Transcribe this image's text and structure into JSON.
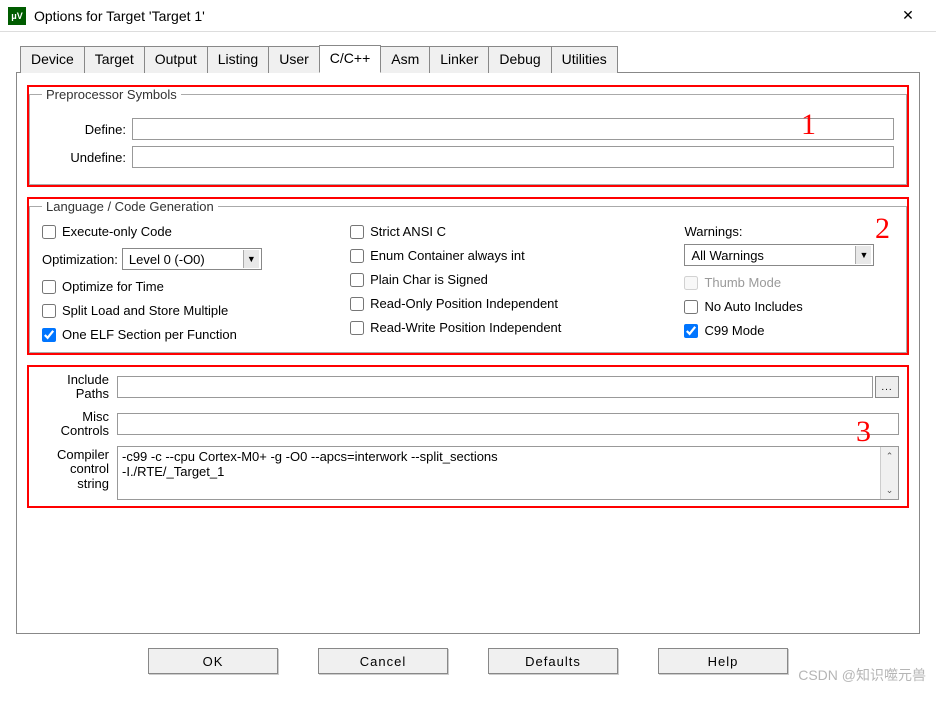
{
  "window": {
    "title": "Options for Target 'Target 1'",
    "icon_label": "μV"
  },
  "tabs": [
    {
      "label": "Device"
    },
    {
      "label": "Target"
    },
    {
      "label": "Output"
    },
    {
      "label": "Listing"
    },
    {
      "label": "User"
    },
    {
      "label": "C/C++"
    },
    {
      "label": "Asm"
    },
    {
      "label": "Linker"
    },
    {
      "label": "Debug"
    },
    {
      "label": "Utilities"
    }
  ],
  "active_tab": "C/C++",
  "preproc": {
    "legend": "Preprocessor Symbols",
    "define_label": "Define:",
    "define_value": "",
    "undefine_label": "Undefine:",
    "undefine_value": ""
  },
  "langgen": {
    "legend": "Language / Code Generation",
    "col1": {
      "exec_only": "Execute-only Code",
      "opt_label": "Optimization:",
      "opt_value": "Level 0 (-O0)",
      "opt_time": "Optimize for Time",
      "split_load": "Split Load and Store Multiple",
      "one_elf": "One ELF Section per Function"
    },
    "col2": {
      "strict_ansi": "Strict ANSI C",
      "enum_int": "Enum Container always int",
      "plain_char": "Plain Char is Signed",
      "ro_pi": "Read-Only Position Independent",
      "rw_pi": "Read-Write Position Independent"
    },
    "col3": {
      "warnings_label": "Warnings:",
      "warnings_value": "All Warnings",
      "thumb": "Thumb Mode",
      "no_auto": "No Auto Includes",
      "c99": "C99 Mode"
    }
  },
  "paths": {
    "include_label1": "Include",
    "include_label2": "Paths",
    "include_value": "",
    "misc_label1": "Misc",
    "misc_label2": "Controls",
    "misc_value": "",
    "compiler_label1": "Compiler",
    "compiler_label2": "control",
    "compiler_label3": "string",
    "compiler_value_line1": "-c99 -c --cpu Cortex-M0+ -g -O0 --apcs=interwork --split_sections",
    "compiler_value_line2": "-I./RTE/_Target_1"
  },
  "annotations": {
    "a1": "1",
    "a2": "2",
    "a3": "3"
  },
  "buttons": {
    "ok": "OK",
    "cancel": "Cancel",
    "defaults": "Defaults",
    "help": "Help"
  },
  "watermark": "CSDN @知识噬元兽"
}
